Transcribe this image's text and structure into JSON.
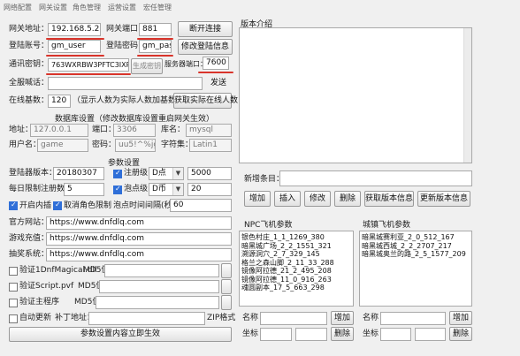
{
  "menu": [
    "网络配置",
    "网关设置",
    "角色管理",
    "运营设置",
    "宏任管理"
  ],
  "gateway": {
    "address_label": "网关地址：",
    "address_value": "192.168.5.235",
    "port_label": "网关端口：",
    "port_value": "881",
    "disconnect_label": "断开连接",
    "account_label": "登陆账号：",
    "account_value": "gm_user",
    "password_label": "登陆密码：",
    "password_value": "gm_pass",
    "modify_login_label": "修改登陆信息",
    "key_label": "通讯密钥：",
    "key_value": "763WXRBW3PFTC3IXPFWH",
    "gen_key_label": "生成密钥",
    "server_port_label": "服务器端口：",
    "server_port_value": "7600",
    "announce_label": "全服喊话：",
    "announce_value": "",
    "send_label": "发送",
    "online_label": "在线基数：",
    "online_value": "120",
    "online_hint": "（显示人数为实际人数加基数）",
    "get_online_label": "获取实际在线人数"
  },
  "db": {
    "title": "数据库设置（修改数据库设置重启网关生效）",
    "addr_label": "地址：",
    "addr_value": "127.0.0.1",
    "port_label": "端口：",
    "port_value": "3306",
    "dbname_label": "库名：",
    "dbname_value": "mysql",
    "user_label": "用户名：",
    "user_value": "game",
    "pass_label": "密码：",
    "pass_value": "uu5!^%jg",
    "charset_label": "字符集：",
    "charset_value": "Latin1"
  },
  "params": {
    "title": "参数设置",
    "version_label": "登陆器版本：",
    "version_value": "20180307",
    "register_label": "注册级",
    "register_currency": "D点",
    "register_value": "5000",
    "daily_label": "每日限制注册数：",
    "daily_value": "5",
    "bubble_label": "泡点级",
    "bubble_currency": "D币",
    "bubble_value": "20",
    "open_inside_label": "开启内插",
    "cancel_role_label": "取消角色限制",
    "bubble_time_label": "泡点时间间隔(秒)",
    "bubble_time_value": "60",
    "site_label": "官方网站：",
    "site_value": "https://www.dnfdlq.com",
    "recharge_label": "游戏充值：",
    "recharge_value": "https://www.dnfdlq.com",
    "contact_label": "抽奖系统：",
    "contact_value": "https://www.dnfdlq.com",
    "verify1_label": "验证1DnfMagical.dll",
    "md5_label": "MD5值",
    "verify2_label": "验证Script.pvf",
    "verify3_label": "验证主程序",
    "auto_update_label": "自动更新",
    "patch_label": "补丁地址：",
    "zip_label": "ZIP格式",
    "save_label": "参数设置内容立即生效"
  },
  "version": {
    "title": "版本介绍",
    "new_item_label": "新增条目：",
    "add_label": "增加",
    "insert_label": "插入",
    "modify_label": "修改",
    "delete_label": "删除",
    "get_info_label": "获取版本信息",
    "update_info_label": "更新版本信息"
  },
  "npc": {
    "title": "NPC飞机参数",
    "items": [
      "银色村庄_1_1_1269_380",
      "暗黑城广场_2_2_1551_321",
      "溯源洞穴_2_7_329_145",
      "格兰之森山脚_2_11_33_288",
      "镜像阿拉德_21_2_495_208",
      "镜像阿拉德_11_0_916_263",
      "魂圆副本_17_5_663_298"
    ],
    "name_label": "名称",
    "coord_label": "坐标",
    "add_label": "增加",
    "delete_label": "删除"
  },
  "city": {
    "title": "城镇飞机参数",
    "items": [
      "暗黑城赛利亚_2_0_512_167",
      "暗黑城西城_2_2_2707_217",
      "暗黑城奥兰的路_2_5_1577_209"
    ],
    "name_label": "名称",
    "coord_label": "坐标",
    "add_label": "增加",
    "delete_label": "删除"
  },
  "colors": {
    "highlight": "#d9342b",
    "accent": "#2f6fd8"
  }
}
